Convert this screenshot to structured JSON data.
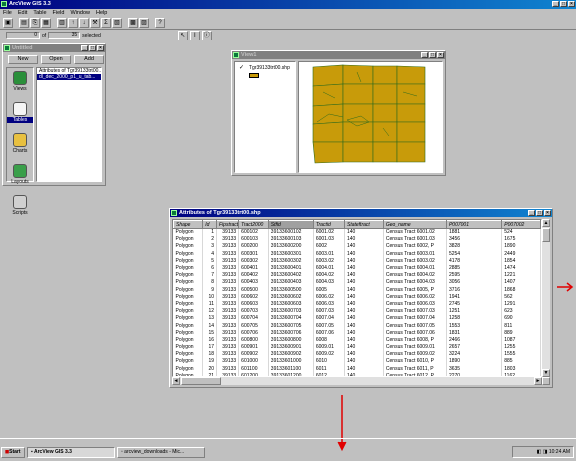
{
  "app": {
    "title": "ArcView GIS 3.3",
    "menus": [
      "File",
      "Edit",
      "Table",
      "Field",
      "Window",
      "Help"
    ],
    "status": {
      "selected_count": "0",
      "of_label": "of",
      "total": "35",
      "selected_label": "selected"
    }
  },
  "toolbar": {
    "buttons": [
      "save-icon",
      "table-icon",
      "copy-icon",
      "paste-icon",
      "calc-icon",
      "sort-asc-icon",
      "sort-desc-icon",
      "query-icon",
      "summary-icon",
      "chart-icon",
      "select-all-icon",
      "promote-icon",
      "help-icon"
    ]
  },
  "project": {
    "title": "Untitled",
    "buttons": {
      "new": "New",
      "open": "Open",
      "add": "Add"
    },
    "categories": [
      "Views",
      "Tables",
      "Charts",
      "Layouts",
      "Scripts"
    ],
    "selected_category": "Tables",
    "items": [
      "Attributes of Tgr39133trt00...",
      "dl_dec_2000_p1_u_tab..."
    ]
  },
  "view": {
    "title": "View1",
    "layer_name": "Tgr39133trt00.shp",
    "layer_color": "#c89b0a"
  },
  "table": {
    "title": "Attributes of Tgr39133trt00.shp",
    "columns": [
      "Shape",
      "Id",
      "Fipstract",
      "Tract2000",
      "Stfid",
      "Tractid",
      "Stateftract",
      "Geo_name",
      "P007001",
      "P007002"
    ],
    "rows": [
      [
        "Polygon",
        "1",
        "39133",
        "600102",
        "39133600102",
        "6001.02",
        "140",
        "Census Tract 6001.02",
        "1881",
        "524"
      ],
      [
        "Polygon",
        "2",
        "39133",
        "600103",
        "39133600103",
        "6001.03",
        "140",
        "Census Tract 6001.03",
        "3456",
        "1675"
      ],
      [
        "Polygon",
        "3",
        "39133",
        "600200",
        "39133600200",
        "6002",
        "140",
        "Census Tract 6002, P",
        "3828",
        "1890"
      ],
      [
        "Polygon",
        "4",
        "39133",
        "600301",
        "39133600301",
        "6003.01",
        "140",
        "Census Tract 6003.01",
        "5254",
        "2449"
      ],
      [
        "Polygon",
        "5",
        "39133",
        "600302",
        "39133600302",
        "6003.02",
        "140",
        "Census Tract 6003.02",
        "4178",
        "1854"
      ],
      [
        "Polygon",
        "6",
        "39133",
        "600401",
        "39133600401",
        "6004.01",
        "140",
        "Census Tract 6004.01",
        "2885",
        "1474"
      ],
      [
        "Polygon",
        "7",
        "39133",
        "600402",
        "39133600402",
        "6004.02",
        "140",
        "Census Tract 6004.02",
        "2595",
        "1221"
      ],
      [
        "Polygon",
        "8",
        "39133",
        "600403",
        "39133600403",
        "6004.03",
        "140",
        "Census Tract 6004.03",
        "3056",
        "1407"
      ],
      [
        "Polygon",
        "9",
        "39133",
        "600500",
        "39133600500",
        "6005",
        "140",
        "Census Tract 6005, P",
        "3716",
        "1868"
      ],
      [
        "Polygon",
        "10",
        "39133",
        "600602",
        "39133600602",
        "6006.02",
        "140",
        "Census Tract 6006.02",
        "1941",
        "562"
      ],
      [
        "Polygon",
        "11",
        "39133",
        "600603",
        "39133600603",
        "6006.03",
        "140",
        "Census Tract 6006.03",
        "2745",
        "1291"
      ],
      [
        "Polygon",
        "12",
        "39133",
        "600703",
        "39133600703",
        "6007.03",
        "140",
        "Census Tract 6007.03",
        "1251",
        "623"
      ],
      [
        "Polygon",
        "13",
        "39133",
        "600704",
        "39133600704",
        "6007.04",
        "140",
        "Census Tract 6007.04",
        "1258",
        "690"
      ],
      [
        "Polygon",
        "14",
        "39133",
        "600705",
        "39133600705",
        "6007.05",
        "140",
        "Census Tract 6007.05",
        "1553",
        "811"
      ],
      [
        "Polygon",
        "15",
        "39133",
        "600706",
        "39133600706",
        "6007.06",
        "140",
        "Census Tract 6007.06",
        "1831",
        "889"
      ],
      [
        "Polygon",
        "16",
        "39133",
        "600800",
        "39133600800",
        "6008",
        "140",
        "Census Tract 6008, P",
        "2466",
        "1087"
      ],
      [
        "Polygon",
        "17",
        "39133",
        "600901",
        "39133600901",
        "6009.01",
        "140",
        "Census Tract 6009.01",
        "2657",
        "1255"
      ],
      [
        "Polygon",
        "18",
        "39133",
        "600902",
        "39133600902",
        "6009.02",
        "140",
        "Census Tract 6009.02",
        "3224",
        "1555"
      ],
      [
        "Polygon",
        "19",
        "39133",
        "601000",
        "39133601000",
        "6010",
        "140",
        "Census Tract 6010, P",
        "1890",
        "885"
      ],
      [
        "Polygon",
        "20",
        "39133",
        "601100",
        "39133601100",
        "6011",
        "140",
        "Census Tract 6011, P",
        "3635",
        "1803"
      ],
      [
        "Polygon",
        "21",
        "39133",
        "601200",
        "39133601200",
        "6012",
        "140",
        "Census Tract 6012, P",
        "2270",
        "1162"
      ]
    ]
  },
  "taskbar": {
    "start": "Start",
    "tasks": [
      "ArcView GIS 3.3",
      "arcview_downloads - Mic..."
    ],
    "clock": "10:24 AM"
  },
  "annotations": {
    "arrow_color": "#e00000"
  }
}
